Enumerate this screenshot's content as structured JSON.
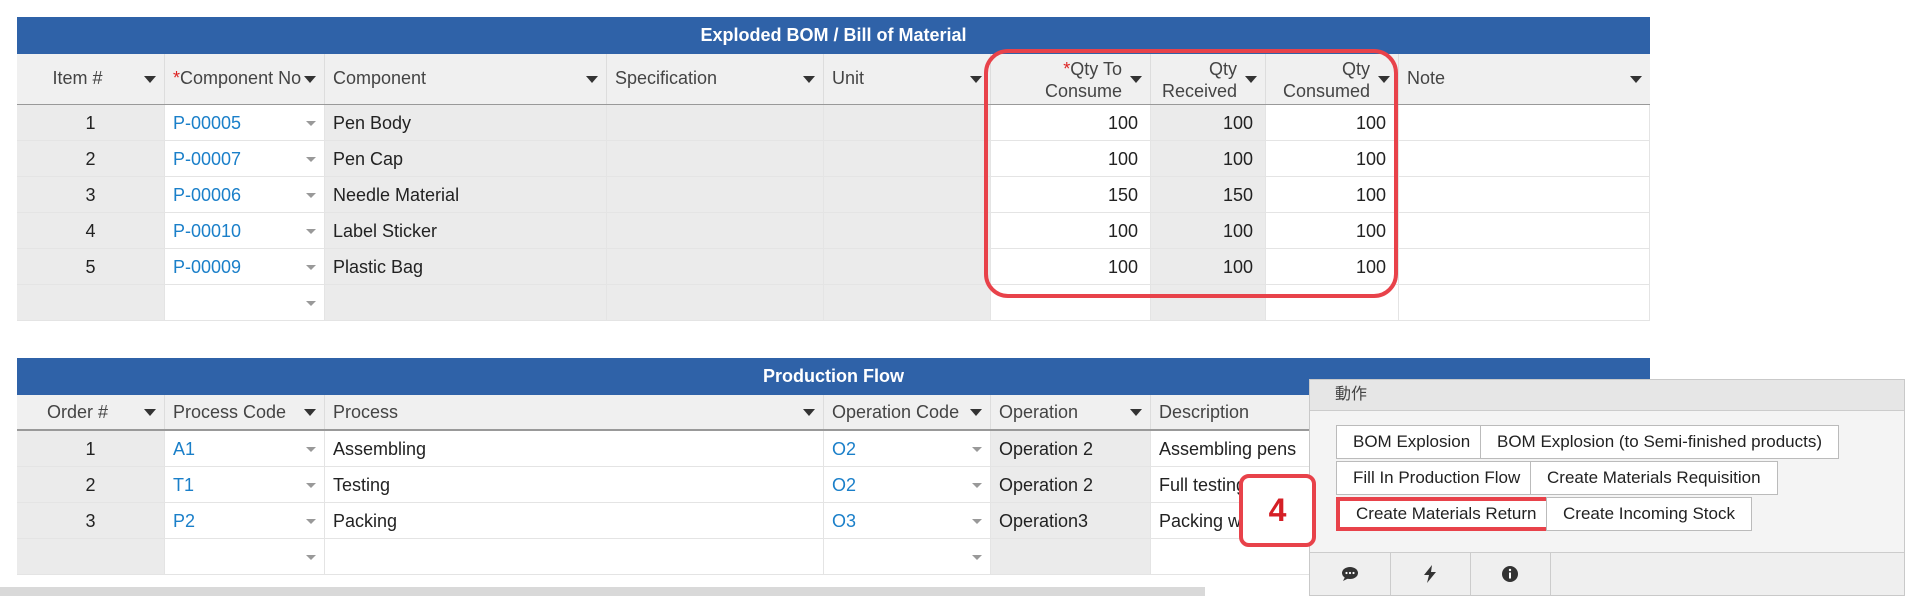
{
  "bom": {
    "title": "Exploded BOM / Bill of Material",
    "headers": {
      "item": "Item #",
      "component_no": "Component No",
      "component": "Component",
      "specification": "Specification",
      "unit": "Unit",
      "qty_to_consume_1": "Qty To",
      "qty_to_consume_2": "Consume",
      "qty_received_1": "Qty",
      "qty_received_2": "Received",
      "qty_consumed_1": "Qty",
      "qty_consumed_2": "Consumed",
      "note": "Note",
      "required_mark": "*"
    },
    "rows": [
      {
        "item": "1",
        "no": "P-00005",
        "component": "Pen Body",
        "to_consume": "100",
        "received": "100",
        "consumed": "100"
      },
      {
        "item": "2",
        "no": "P-00007",
        "component": "Pen Cap",
        "to_consume": "100",
        "received": "100",
        "consumed": "100"
      },
      {
        "item": "3",
        "no": "P-00006",
        "component": "Needle Material",
        "to_consume": "150",
        "received": "150",
        "consumed": "100"
      },
      {
        "item": "4",
        "no": "P-00010",
        "component": "Label Sticker",
        "to_consume": "100",
        "received": "100",
        "consumed": "100"
      },
      {
        "item": "5",
        "no": "P-00009",
        "component": "Plastic Bag",
        "to_consume": "100",
        "received": "100",
        "consumed": "100"
      }
    ]
  },
  "flow": {
    "title": "Production Flow",
    "headers": {
      "order": "Order #",
      "process_code": "Process Code",
      "process": "Process",
      "operation_code": "Operation Code",
      "operation": "Operation",
      "description": "Description"
    },
    "rows": [
      {
        "order": "1",
        "pcode": "A1",
        "process": "Assembling",
        "ocode": "O2",
        "operation": "Operation 2",
        "description": "Assembling pens"
      },
      {
        "order": "2",
        "pcode": "T1",
        "process": "Testing",
        "ocode": "O2",
        "operation": "Operation 2",
        "description": "Full testing"
      },
      {
        "order": "3",
        "pcode": "P2",
        "process": "Packing",
        "ocode": "O3",
        "operation": "Operation3",
        "description": "Packing w"
      }
    ]
  },
  "actions": {
    "title": "動作",
    "buttons": {
      "bom_explosion": "BOM Explosion",
      "bom_explosion_semi": "BOM Explosion (to Semi-finished products)",
      "fill_flow": "Fill In Production Flow",
      "create_requisition": "Create Materials Requisition",
      "create_return": "Create Materials Return",
      "create_incoming": "Create Incoming Stock"
    },
    "toolbar_icons": [
      "comment-icon",
      "lightning-icon",
      "info-icon"
    ]
  },
  "callout": {
    "number": "4"
  },
  "colors": {
    "header_band": "#2f62a8",
    "highlight": "#e8424a",
    "link": "#1a7fc9"
  }
}
